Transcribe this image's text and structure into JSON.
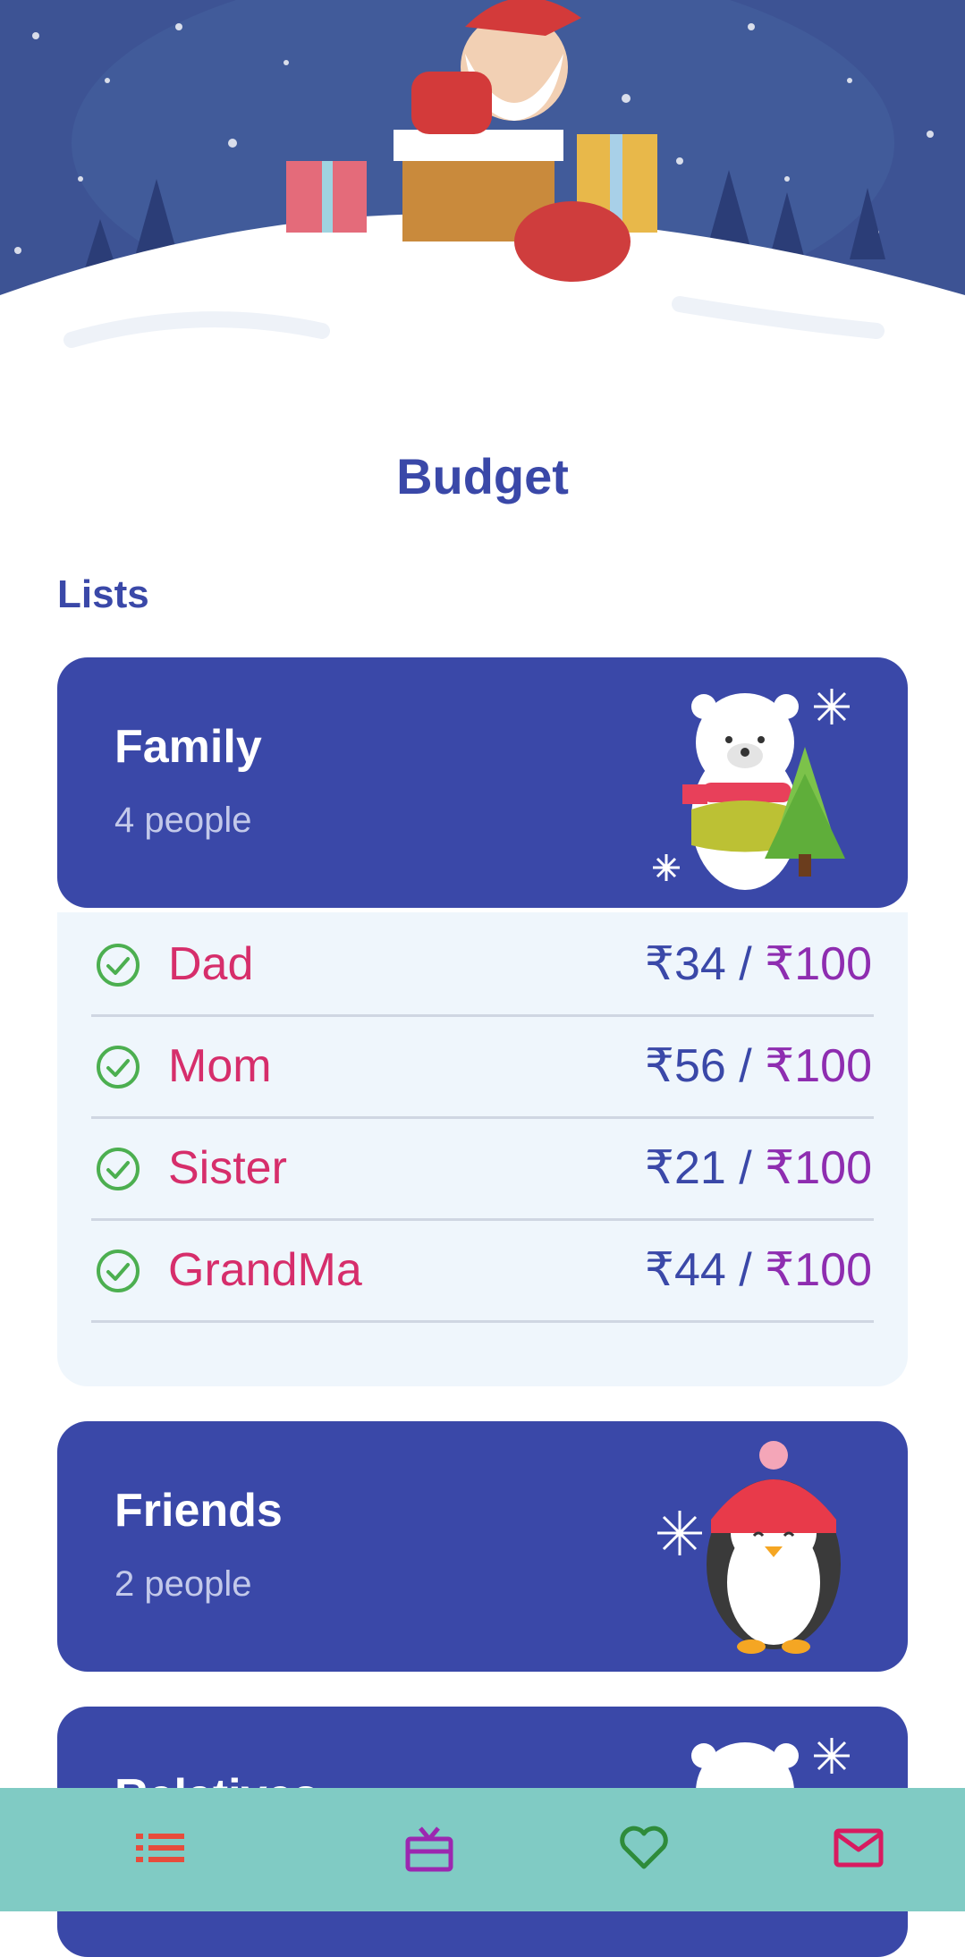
{
  "page": {
    "title": "Budget",
    "section_label": "Lists"
  },
  "groups": [
    {
      "title": "Family",
      "subtitle": "4 people",
      "illustration": "polar-bear-with-tree",
      "expanded": true
    },
    {
      "title": "Friends",
      "subtitle": "2 people",
      "illustration": "penguin-in-hat",
      "expanded": false
    },
    {
      "title": "Relatives",
      "subtitle": "",
      "illustration": "polar-bear-with-tree",
      "expanded": false
    }
  ],
  "members": [
    {
      "name": "Dad",
      "spent": "₹34",
      "separator": " / ",
      "limit": "₹100",
      "icon": "check-circle-icon"
    },
    {
      "name": "Mom",
      "spent": "₹56",
      "separator": " / ",
      "limit": "₹100",
      "icon": "check-circle-icon"
    },
    {
      "name": "Sister",
      "spent": "₹21",
      "separator": " / ",
      "limit": "₹100",
      "icon": "check-circle-icon"
    },
    {
      "name": "GrandMa",
      "spent": "₹44",
      "separator": " / ",
      "limit": "₹100",
      "icon": "check-circle-icon"
    }
  ],
  "bottom_nav": [
    {
      "icon": "list-icon",
      "color": "#e74c3c"
    },
    {
      "icon": "gift-icon",
      "color": "#9c27b0"
    },
    {
      "icon": "heart-icon",
      "color": "#2e8b3a"
    },
    {
      "icon": "mail-icon",
      "color": "#d81b60"
    }
  ],
  "colors": {
    "primary": "#3a48a8",
    "member_name": "#d62e6b",
    "limit": "#8e2db0",
    "check": "#4caf50",
    "nav_bg": "#80cbc4"
  }
}
